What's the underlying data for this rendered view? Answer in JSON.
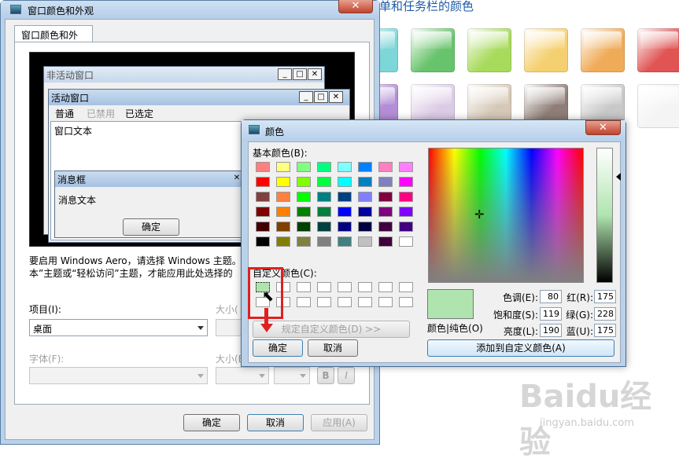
{
  "background_page": {
    "heading": "单和任务栏的颜色",
    "tiles": [
      "#7dd6d8",
      "#68c46c",
      "#a8da5c",
      "#f5d070",
      "#f0ab58",
      "#e05454",
      "#b38ed6",
      "#dccbe6",
      "#d6c8b6",
      "#8f7e78",
      "#c8c8c8",
      "#f4f4f4"
    ]
  },
  "main_window": {
    "title": "窗口颜色和外观",
    "close_glyph": "✕",
    "tab": "窗口颜色和外观",
    "preview": {
      "inactive_title": "非活动窗口",
      "active_title": "活动窗口",
      "menu": [
        "普通",
        "已禁用",
        "已选定"
      ],
      "window_text": "窗口文本",
      "msgbox_title": "消息框",
      "msgbox_text": "消息文本",
      "msgbox_ok": "确定",
      "min_glyph": "_",
      "max_glyph": "□",
      "close_glyph": "✕"
    },
    "info_line1": "要启用 Windows Aero，请选择 Windows 主题。",
    "info_line2": "本”主题或“轻松访问”主题，才能应用此处选择的",
    "item_label": "项目(I):",
    "item_value": "桌面",
    "size_label1": "大小(",
    "font_label": "字体(F):",
    "size_label2": "大小(E",
    "bold_label": "B",
    "italic_label": "I",
    "ok": "确定",
    "cancel": "取消",
    "apply": "应用(A)"
  },
  "color_dialog": {
    "title": "颜色",
    "close_glyph": "✕",
    "basic_colors_label": "基本颜色(B):",
    "basic_colors": [
      [
        "#ff8080",
        "#ffff80",
        "#80ff80",
        "#00ff80",
        "#80ffff",
        "#0080ff",
        "#ff80c0",
        "#ff80ff"
      ],
      [
        "#ff0000",
        "#ffff00",
        "#80ff00",
        "#00ff40",
        "#00ffff",
        "#0080c0",
        "#8080c0",
        "#ff00ff"
      ],
      [
        "#804040",
        "#ff8040",
        "#00ff00",
        "#008080",
        "#004080",
        "#8080ff",
        "#800040",
        "#ff0080"
      ],
      [
        "#800000",
        "#ff8000",
        "#008000",
        "#008040",
        "#0000ff",
        "#0000a0",
        "#800080",
        "#8000ff"
      ],
      [
        "#400000",
        "#804000",
        "#004000",
        "#004040",
        "#000080",
        "#000040",
        "#400040",
        "#400080"
      ],
      [
        "#000000",
        "#808000",
        "#808040",
        "#808080",
        "#408080",
        "#c0c0c0",
        "#400040",
        "#ffffff"
      ]
    ],
    "custom_colors_label": "自定义颜色(C):",
    "custom_colors": [
      "#afe4af",
      "#ffffff",
      "#ffffff",
      "#ffffff",
      "#ffffff",
      "#ffffff",
      "#ffffff",
      "#ffffff",
      "#ffffff",
      "#ffffff",
      "#ffffff",
      "#ffffff",
      "#ffffff",
      "#ffffff",
      "#ffffff",
      "#ffffff"
    ],
    "define_custom": "规定自定义颜色(D) >>",
    "ok": "确定",
    "cancel": "取消",
    "color_solid_label": "颜色|纯色(O)",
    "hue_label": "色调(E):",
    "hue": "80",
    "sat_label": "饱和度(S):",
    "sat": "119",
    "lum_label": "亮度(L):",
    "lum": "190",
    "red_label": "红(R):",
    "red": "175",
    "green_label": "绿(G):",
    "green": "228",
    "blue_label": "蓝(U):",
    "blue": "175",
    "add_custom": "添加到自定义颜色(A)"
  },
  "watermark": {
    "logo": "Baidu经验",
    "url": "jingyan.baidu.com"
  }
}
